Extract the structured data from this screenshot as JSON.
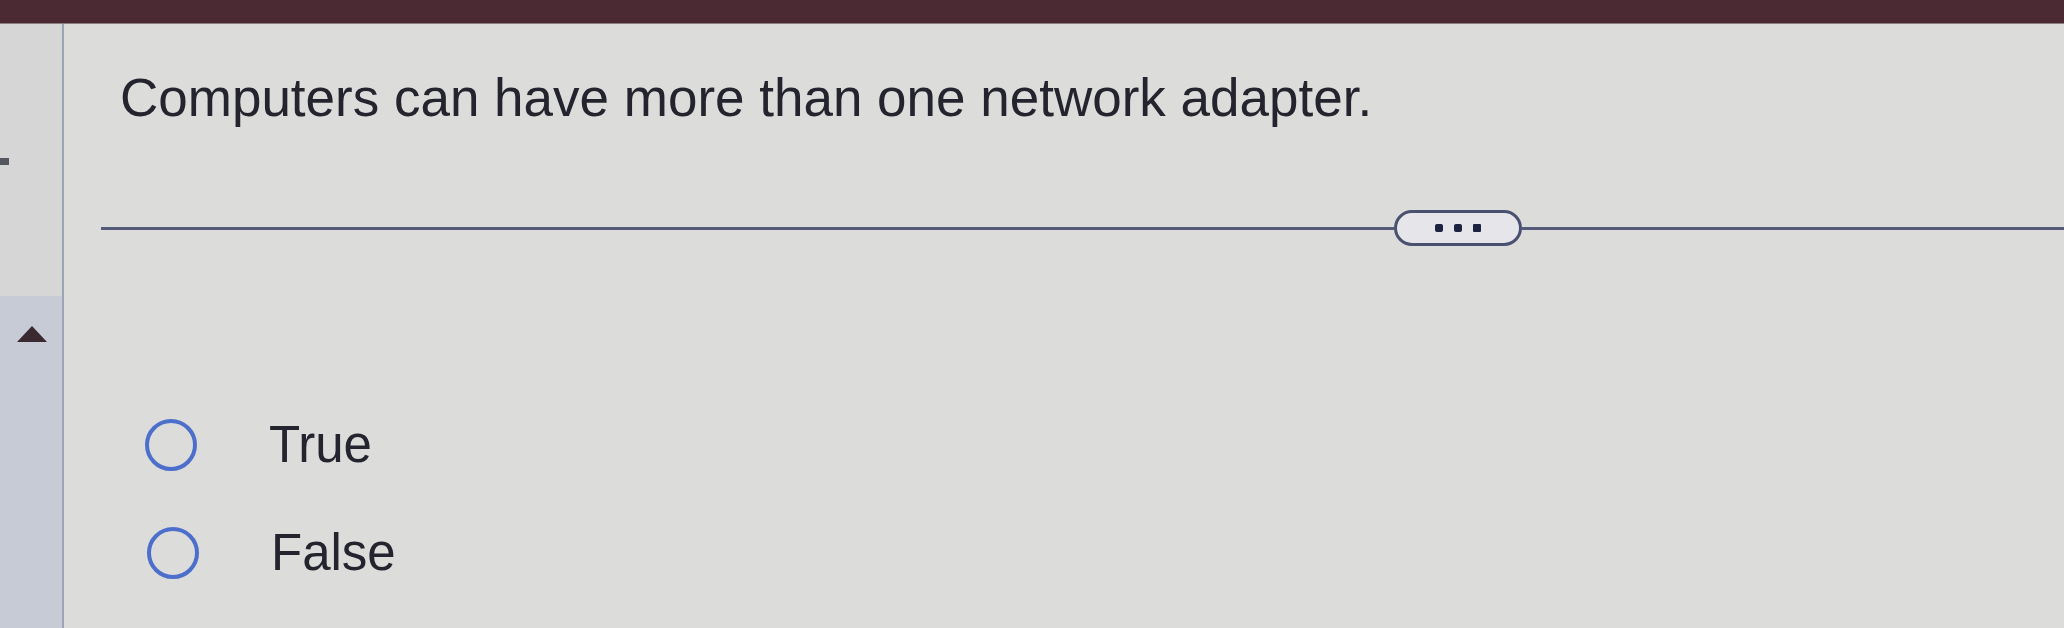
{
  "question": {
    "text": "Computers can have more than one network adapter."
  },
  "options": [
    {
      "label": "True",
      "selected": false
    },
    {
      "label": "False",
      "selected": false
    }
  ]
}
